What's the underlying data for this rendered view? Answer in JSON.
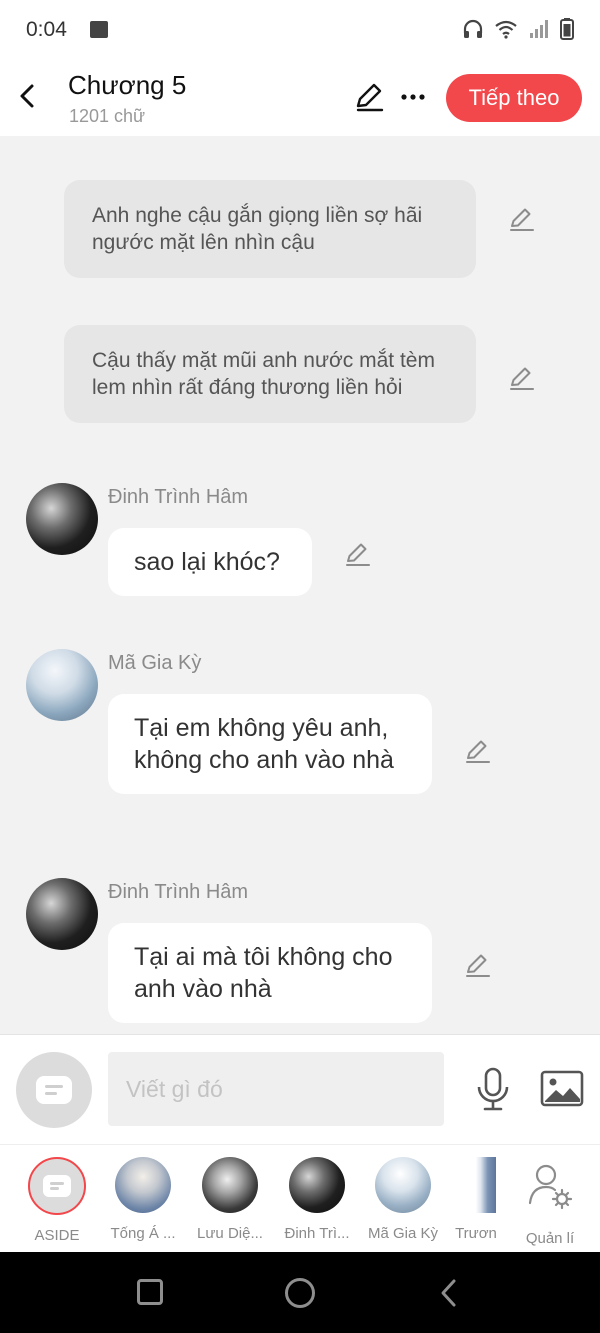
{
  "status_bar": {
    "time": "0:04",
    "icons": [
      "gallery-icon",
      "headphones-icon",
      "wifi-icon",
      "signal-icon",
      "battery-icon"
    ]
  },
  "header": {
    "title": "Chương 5",
    "subtitle": "1201 chữ",
    "next_label": "Tiếp theo",
    "accent_color": "#f2474b"
  },
  "messages": [
    {
      "type": "narration",
      "text": "Anh nghe cậu gắn giọng liền sợ hãi ngước mặt lên nhìn cậu"
    },
    {
      "type": "narration",
      "text": "Cậu thấy mặt mũi anh nước mắt tèm lem nhìn rất đáng thương liền hỏi"
    },
    {
      "type": "dialogue",
      "sender": "Đinh Trình Hâm",
      "text": "sao lại khóc?"
    },
    {
      "type": "dialogue",
      "sender": "Mã Gia Kỳ",
      "text": "Tại em không yêu anh, không cho anh vào nhà"
    },
    {
      "type": "dialogue",
      "sender": "Đinh Trình Hâm",
      "text": "Tại ai mà tôi không cho anh vào nhà"
    }
  ],
  "input": {
    "placeholder": "Viết gì đó"
  },
  "characters": [
    {
      "name": "ASIDE",
      "selected": true
    },
    {
      "name": "Tống Á ..."
    },
    {
      "name": "Lưu Diệ..."
    },
    {
      "name": "Đinh Trì..."
    },
    {
      "name": "Mã Gia Kỳ"
    },
    {
      "name": "Trươn"
    },
    {
      "name": "Quản lí"
    }
  ]
}
